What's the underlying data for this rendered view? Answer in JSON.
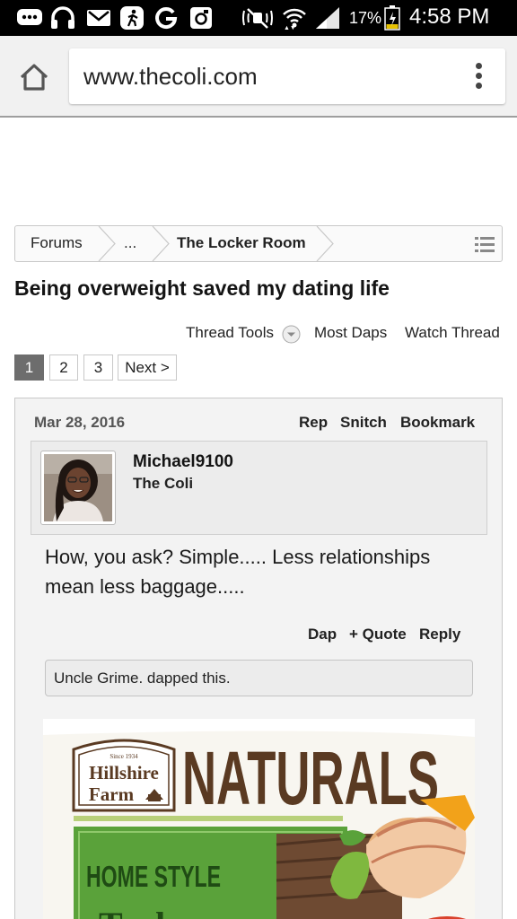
{
  "status_bar": {
    "battery_percent": "17%",
    "time": "4:58 PM",
    "icons": [
      "messenger-icon",
      "headphones-icon",
      "mail-icon",
      "fitness-icon",
      "google-icon",
      "instagram-icon",
      "mute-icon",
      "wifi-icon",
      "signal-icon",
      "battery-icon"
    ]
  },
  "browser": {
    "url": "www.thecoli.com"
  },
  "breadcrumb": {
    "items": [
      "Forums",
      "...",
      "The Locker Room"
    ]
  },
  "thread": {
    "title": "Being overweight saved my dating life",
    "tools": [
      "Thread Tools",
      "Most Daps",
      "Watch Thread"
    ]
  },
  "pagination": {
    "pages": [
      "1",
      "2",
      "3"
    ],
    "current": "1",
    "next_label": "Next >"
  },
  "post": {
    "date": "Mar 28, 2016",
    "actions": [
      "Rep",
      "Snitch",
      "Bookmark"
    ],
    "username": "Michael9100",
    "user_title": "The Coli",
    "body": "How, you ask? Simple..... Less relationships mean less baggage.....",
    "footer_actions": [
      "Dap",
      "+ Quote",
      "Reply"
    ],
    "dapped_by": "Uncle Grime. dapped this."
  },
  "ad": {
    "brand_since": "Since 1934",
    "brand_line1": "Hillshire",
    "brand_line2": "Farm",
    "headline": "NATURALS",
    "tagline": "HOME STYLE",
    "partial_text": "Turkey"
  },
  "colors": {
    "status_bar_bg": "#000000",
    "current_page_bg": "#6d6d6d",
    "ad_brown": "#5a3a22",
    "ad_green": "#5aa23a"
  }
}
